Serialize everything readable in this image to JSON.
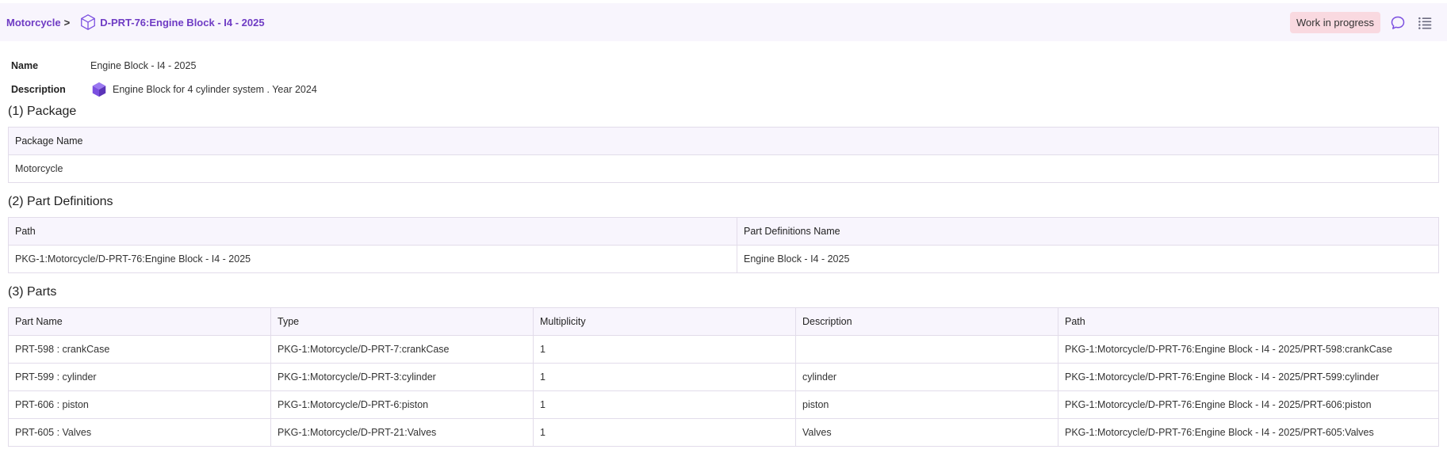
{
  "breadcrumb": {
    "root": "Motorcycle",
    "separator": ">",
    "current": "D-PRT-76:Engine Block - I4 - 2025"
  },
  "header": {
    "status": "Work in progress",
    "icons": [
      "comment-icon",
      "list-icon"
    ]
  },
  "properties": {
    "name_label": "Name",
    "name_value": "Engine Block - I4 - 2025",
    "description_label": "Description",
    "description_value": "Engine Block for 4 cylinder system . Year 2024"
  },
  "package_section": {
    "title": "(1) Package",
    "columns": [
      "Package Name"
    ],
    "rows": [
      [
        "Motorcycle"
      ]
    ]
  },
  "part_definitions_section": {
    "title": "(2) Part Definitions",
    "columns": [
      "Path",
      "Part Definitions Name"
    ],
    "rows": [
      [
        "PKG-1:Motorcycle/D-PRT-76:Engine Block - I4 - 2025",
        "Engine Block - I4 - 2025"
      ]
    ]
  },
  "parts_section": {
    "title": "(3) Parts",
    "columns": [
      "Part Name",
      "Type",
      "Multiplicity",
      "Description",
      "Path"
    ],
    "rows": [
      [
        "PRT-598 : crankCase",
        "PKG-1:Motorcycle/D-PRT-7:crankCase",
        "1",
        "",
        "PKG-1:Motorcycle/D-PRT-76:Engine Block - I4 - 2025/PRT-598:crankCase"
      ],
      [
        "PRT-599 : cylinder",
        "PKG-1:Motorcycle/D-PRT-3:cylinder",
        "1",
        "cylinder",
        "PKG-1:Motorcycle/D-PRT-76:Engine Block - I4 - 2025/PRT-599:cylinder"
      ],
      [
        "PRT-606 : piston",
        "PKG-1:Motorcycle/D-PRT-6:piston",
        "1",
        "piston",
        "PKG-1:Motorcycle/D-PRT-76:Engine Block - I4 - 2025/PRT-606:piston"
      ],
      [
        "PRT-605 : Valves",
        "PKG-1:Motorcycle/D-PRT-21:Valves",
        "1",
        "Valves",
        "PKG-1:Motorcycle/D-PRT-76:Engine Block - I4 - 2025/PRT-605:Valves"
      ]
    ]
  },
  "colors": {
    "accent": "#6f3cc4",
    "header_bg": "#f8f5fd",
    "status_bg": "#f9d9e0",
    "cube_fill": "#7b4fe0"
  }
}
